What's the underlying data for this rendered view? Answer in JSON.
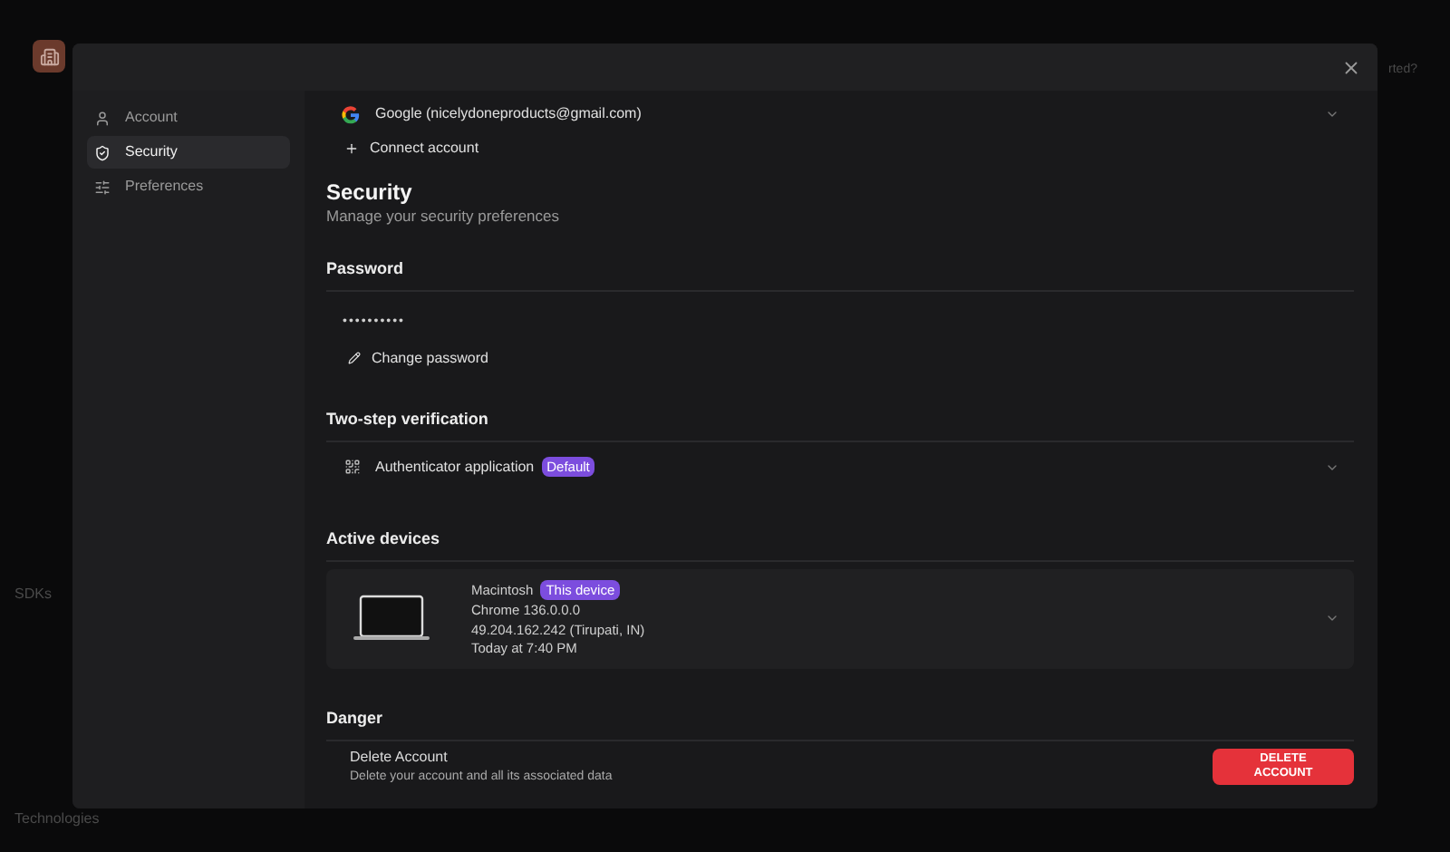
{
  "background": {
    "top_right_text": "rted?",
    "sections": [
      {
        "title": "SDKs"
      },
      {
        "title": "Technologies"
      }
    ]
  },
  "sidebar": {
    "items": [
      {
        "label": "Account",
        "selected": false
      },
      {
        "label": "Security",
        "selected": true
      },
      {
        "label": "Preferences",
        "selected": false
      }
    ]
  },
  "connected_accounts": [
    {
      "label": "Google (nicelydoneproducts@gmail.com)"
    }
  ],
  "connect_button": "Connect account",
  "header": {
    "title": "Security",
    "subtitle": "Manage your security preferences"
  },
  "password": {
    "title": "Password",
    "value": "••••••••••",
    "action": "Change password"
  },
  "two_step": {
    "title": "Two-step verification",
    "methods": [
      {
        "label": "Authenticator application",
        "badge": "Default"
      }
    ]
  },
  "devices": {
    "title": "Active devices",
    "items": [
      {
        "name": "Macintosh",
        "badge": "This device",
        "browser": "Chrome 136.0.0.0",
        "ip": "49.204.162.242 (Tirupati, IN)",
        "time": "Today at 7:40 PM"
      }
    ]
  },
  "danger": {
    "title": "Danger",
    "item_title": "Delete Account",
    "item_desc": "Delete your account and all its associated data",
    "button": "DELETE ACCOUNT"
  }
}
